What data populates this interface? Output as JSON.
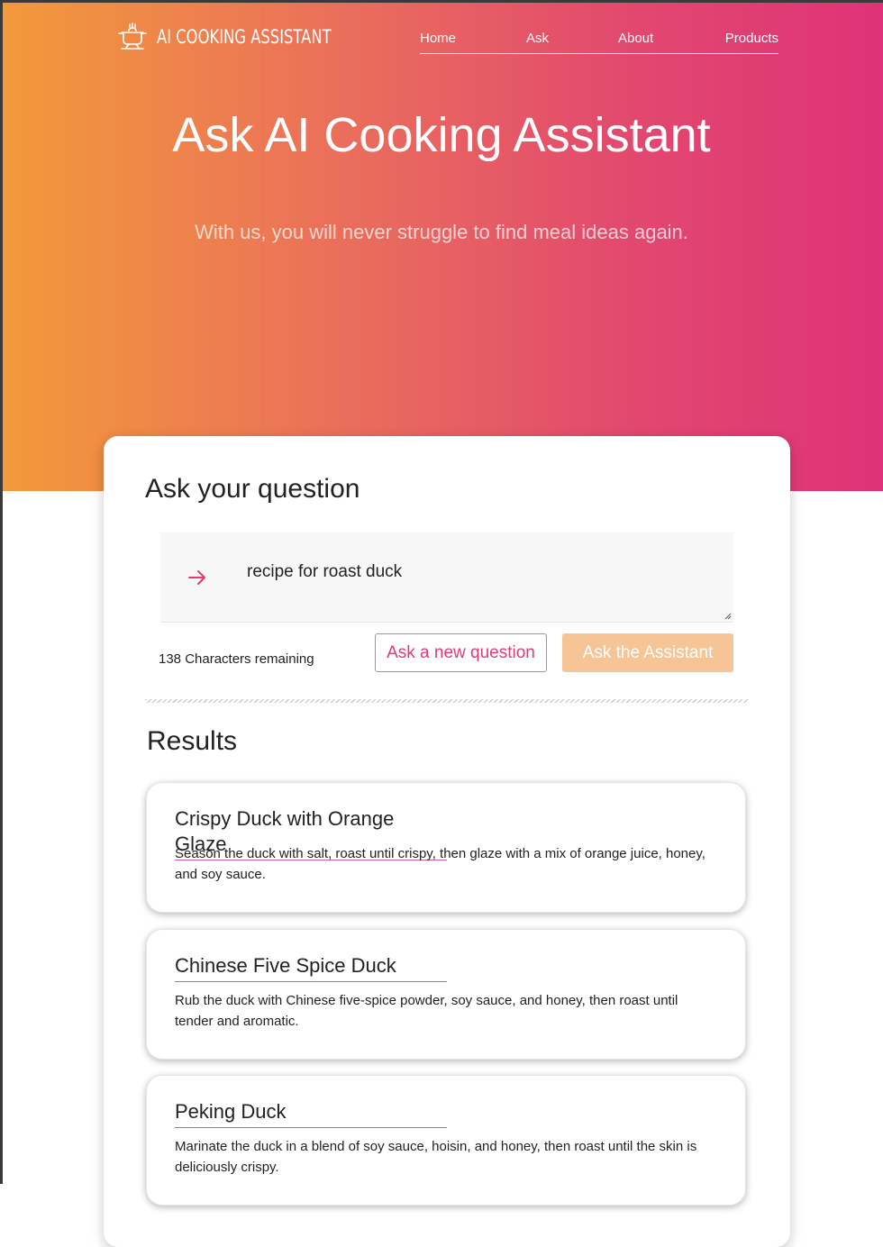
{
  "brand": {
    "name": "AI COOKING ASSISTANT",
    "icon": "cooking-pot-icon"
  },
  "nav": {
    "items": [
      "Home",
      "Ask",
      "About",
      "Products"
    ]
  },
  "hero": {
    "title": "Ask AI Cooking Assistant",
    "subtitle": "With us, you will never struggle to find meal ideas again."
  },
  "ask": {
    "title": "Ask your question",
    "question_value": "recipe for roast duck",
    "input_icon": "arrow-right-icon",
    "chars_remaining": "138 Characters remaining",
    "new_question_label": "Ask a new question",
    "ask_label": "Ask the Assistant"
  },
  "results": {
    "title": "Results",
    "items": [
      {
        "title": "Crispy Duck with Orange Glaze",
        "description": "Season the duck with salt, roast until crispy, then glaze with a mix of orange juice, honey, and soy sauce."
      },
      {
        "title": "Chinese Five Spice Duck",
        "description": "Rub the duck with Chinese five-spice powder, soy sauce, and honey, then roast until tender and aromatic."
      },
      {
        "title": "Peking Duck",
        "description": "Marinate the duck in a blend of soy sauce, hoisin, and honey, then roast until the skin is deliciously crispy."
      }
    ]
  },
  "colors": {
    "gradient_start": "#f29a3a",
    "gradient_end": "#df3278",
    "accent_pink": "#e03a78",
    "ask_button": "#f7c595"
  }
}
